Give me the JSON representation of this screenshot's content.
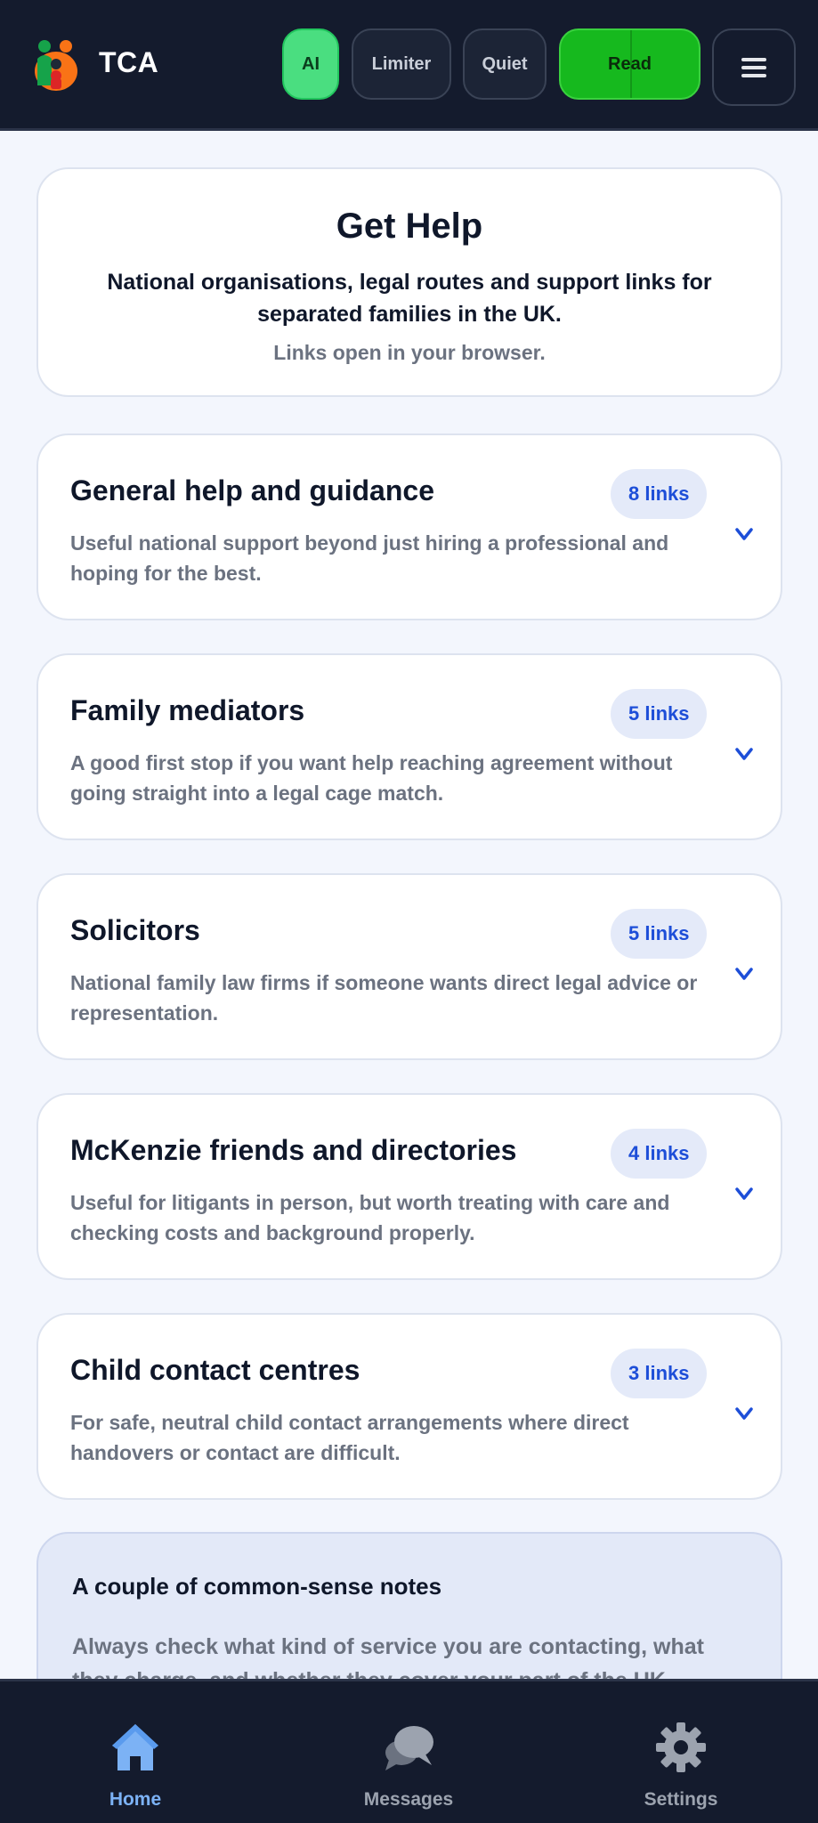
{
  "header": {
    "brand": "TCA",
    "buttons": {
      "ai": "AI",
      "limiter": "Limiter",
      "quiet": "Quiet",
      "read": "Read"
    },
    "menu_icon": "hamburger-icon",
    "logo_icon": "family-logo-icon"
  },
  "intro": {
    "title": "Get Help",
    "subtitle": "National organisations, legal routes and support links for separated families in the UK.",
    "note": "Links open in your browser."
  },
  "categories": [
    {
      "title": "General help and guidance",
      "badge": "8 links",
      "description": "Useful national support beyond just hiring a professional and hoping for the best."
    },
    {
      "title": "Family mediators",
      "badge": "5 links",
      "description": "A good first stop if you want help reaching agreement without going straight into a legal cage match."
    },
    {
      "title": "Solicitors",
      "badge": "5 links",
      "description": "National family law firms if someone wants direct legal advice or representation."
    },
    {
      "title": "McKenzie friends and directories",
      "badge": "4 links",
      "description": "Useful for litigants in person, but worth treating with care and checking costs and background properly."
    },
    {
      "title": "Child contact centres",
      "badge": "3 links",
      "description": "For safe, neutral child contact arrangements where direct handovers or contact are difficult."
    }
  ],
  "notes": {
    "title": "A couple of common-sense notes",
    "body": "Always check what kind of service you are contacting, what they charge, and whether they cover your part of the UK."
  },
  "bottom_nav": {
    "home": "Home",
    "messages": "Messages",
    "settings": "Settings",
    "home_icon": "house-icon",
    "messages_icon": "chat-bubbles-icon",
    "settings_icon": "gear-icon"
  },
  "colors": {
    "topbar": "#141b2d",
    "accent_green": "#16b91e",
    "ai_green": "#4ade80",
    "link_blue": "#1d4ed8",
    "page_bg": "#f3f6fd"
  }
}
